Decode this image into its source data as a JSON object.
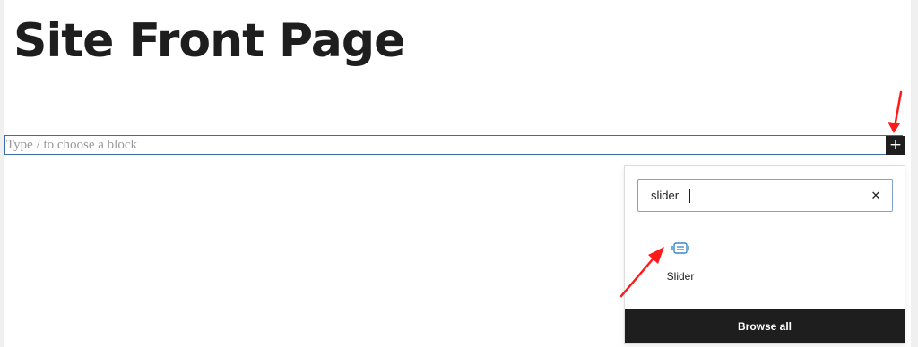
{
  "page": {
    "title": "Site Front Page"
  },
  "editor": {
    "block_placeholder": "Type / to choose a block",
    "inserter_toggle_symbol": "+"
  },
  "inserter": {
    "search_value": "slider",
    "clear_symbol": "✕",
    "results": [
      {
        "label": "Slider",
        "icon": "slider-block-icon"
      }
    ],
    "browse_all_label": "Browse all"
  },
  "colors": {
    "dark": "#1e1e1e",
    "accent_blue": "#3a6ea5",
    "slider_icon": "#3a86c8",
    "annotation_arrow": "#ff1a1a"
  }
}
